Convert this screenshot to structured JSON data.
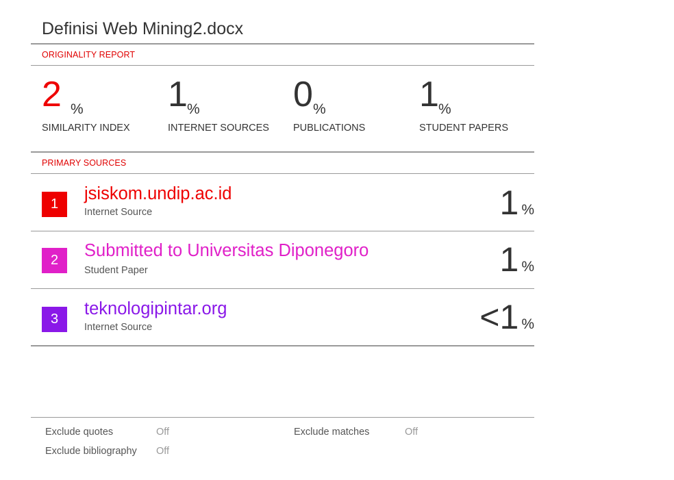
{
  "document": {
    "title": "Definisi Web Mining2.docx"
  },
  "report": {
    "section_label": "ORIGINALITY REPORT",
    "stats": [
      {
        "value": "2",
        "unit": "%",
        "label": "SIMILARITY INDEX",
        "color": "#ee0000"
      },
      {
        "value": "1",
        "unit": "%",
        "label": "INTERNET SOURCES",
        "color": "#333333"
      },
      {
        "value": "0",
        "unit": "%",
        "label": "PUBLICATIONS",
        "color": "#333333"
      },
      {
        "value": "1",
        "unit": "%",
        "label": "STUDENT PAPERS",
        "color": "#333333"
      }
    ]
  },
  "primary_sources": {
    "section_label": "PRIMARY SOURCES",
    "items": [
      {
        "rank": "1",
        "name": "jsiskom.undip.ac.id",
        "type": "Internet Source",
        "percent": "1",
        "unit": "%",
        "color": "#ee0000"
      },
      {
        "rank": "2",
        "name": "Submitted to Universitas Diponegoro",
        "type": "Student Paper",
        "percent": "1",
        "unit": "%",
        "color": "#e020c8"
      },
      {
        "rank": "3",
        "name": "teknologipintar.org",
        "type": "Internet Source",
        "percent": "<1",
        "unit": "%",
        "color": "#8a18e8"
      }
    ]
  },
  "footer": {
    "exclude_quotes": {
      "label": "Exclude quotes",
      "value": "Off"
    },
    "exclude_bibliography": {
      "label": "Exclude bibliography",
      "value": "Off"
    },
    "exclude_matches": {
      "label": "Exclude matches",
      "value": "Off"
    }
  }
}
